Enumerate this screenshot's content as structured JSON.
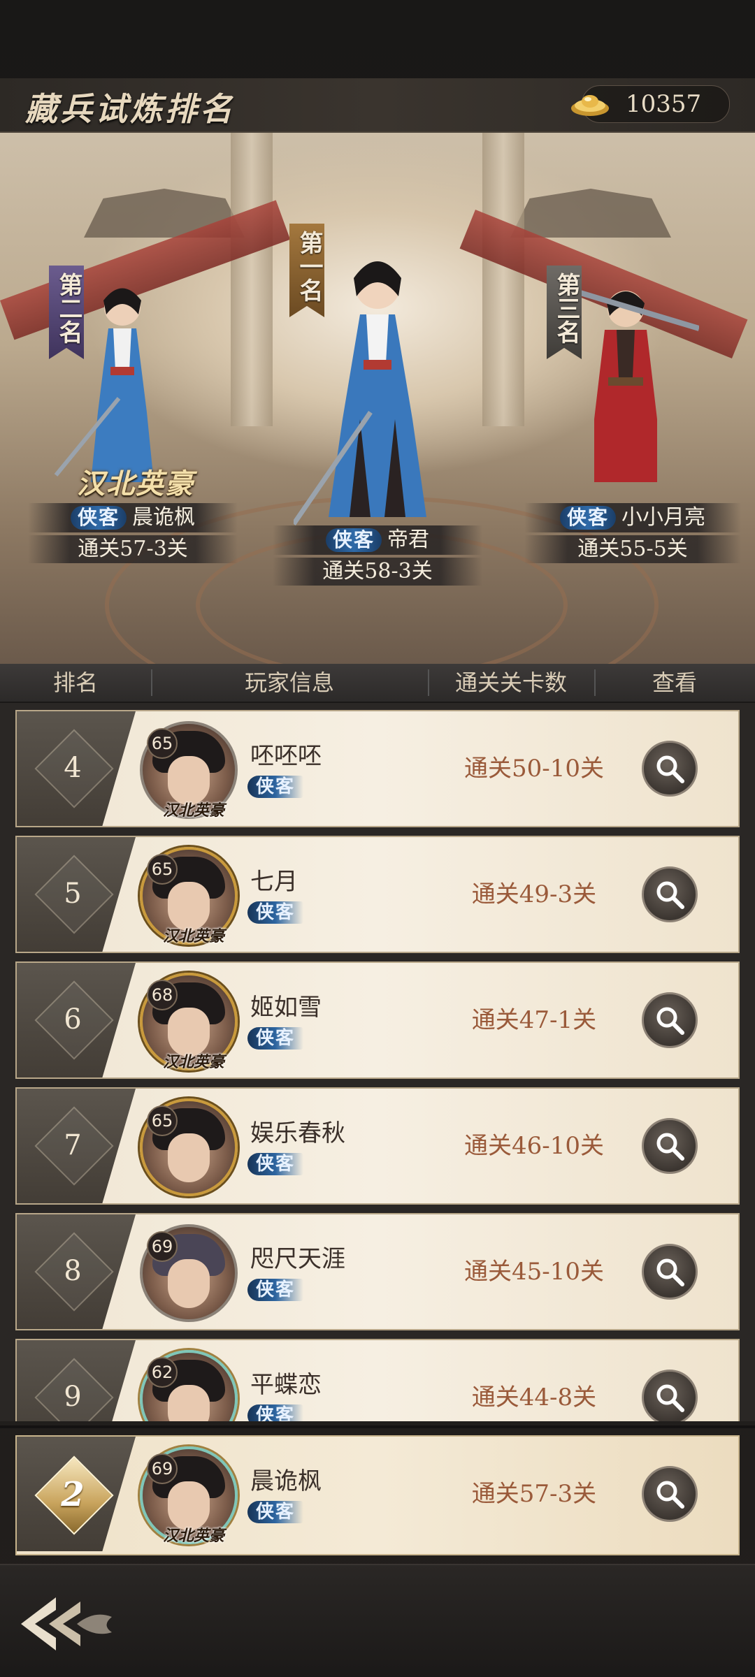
{
  "header": {
    "title": "藏兵试炼排名",
    "currency_icon": "gold-ingot-icon",
    "currency_value": "10357"
  },
  "podium": [
    {
      "rank_label": "第一名",
      "tag": "侠客",
      "name": "帝君",
      "stage": "通关58-3关"
    },
    {
      "rank_label": "第二名",
      "tag": "侠客",
      "name": "晨诡枫",
      "stage": "通关57-3关",
      "title_badge": "汉北英豪"
    },
    {
      "rank_label": "第三名",
      "tag": "侠客",
      "name": "小小月亮",
      "stage": "通关55-5关"
    }
  ],
  "columns": {
    "rank": "排名",
    "player_info": "玩家信息",
    "stage_count": "通关关卡数",
    "view": "查看"
  },
  "rows": [
    {
      "rank": "4",
      "level": "65",
      "name": "呸呸呸",
      "tag": "侠客",
      "stage": "通关50-10关",
      "avatar_title": "汉北英豪",
      "frame": "silver"
    },
    {
      "rank": "5",
      "level": "65",
      "name": "七月",
      "tag": "侠客",
      "stage": "通关49-3关",
      "avatar_title": "汉北英豪",
      "frame": "gold"
    },
    {
      "rank": "6",
      "level": "68",
      "name": "姬如雪",
      "tag": "侠客",
      "stage": "通关47-1关",
      "avatar_title": "汉北英豪",
      "frame": "gold"
    },
    {
      "rank": "7",
      "level": "65",
      "name": "娱乐春秋",
      "tag": "侠客",
      "stage": "通关46-10关",
      "frame": "gold"
    },
    {
      "rank": "8",
      "level": "69",
      "name": "咫尺天涯",
      "tag": "侠客",
      "stage": "通关45-10关",
      "frame": "silver"
    },
    {
      "rank": "9",
      "level": "62",
      "name": "平蝶恋",
      "tag": "侠客",
      "stage": "通关44-8关",
      "frame": "teal"
    }
  ],
  "self_row": {
    "rank": "2",
    "level": "69",
    "name": "晨诡枫",
    "tag": "侠客",
    "stage": "通关57-3关",
    "avatar_title": "汉北英豪",
    "frame": "teal"
  },
  "icons": {
    "view": "search-icon",
    "back": "back-arrow-icon"
  }
}
